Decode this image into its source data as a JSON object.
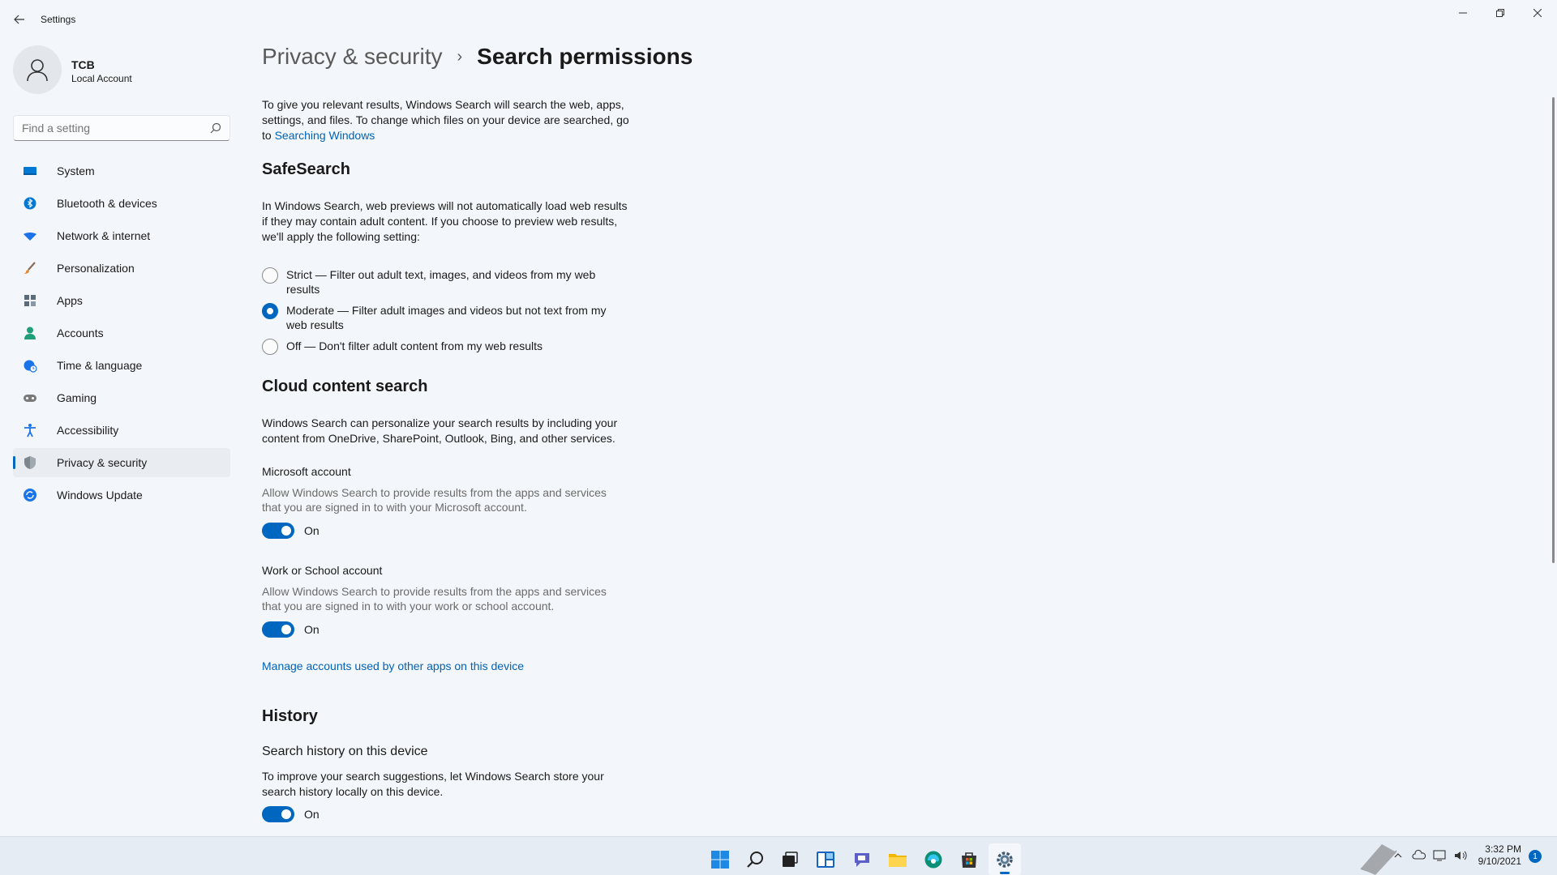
{
  "window": {
    "title": "Settings"
  },
  "profile": {
    "name": "TCB",
    "account_type": "Local Account"
  },
  "search": {
    "placeholder": "Find a setting"
  },
  "sidebar": {
    "items": [
      {
        "label": "System",
        "icon": "system-icon",
        "color": "#0078d4"
      },
      {
        "label": "Bluetooth & devices",
        "icon": "bluetooth-icon",
        "color": "#0078d4"
      },
      {
        "label": "Network & internet",
        "icon": "wifi-icon",
        "color": "#1a73e8"
      },
      {
        "label": "Personalization",
        "icon": "brush-icon",
        "color": "#c16c3a"
      },
      {
        "label": "Apps",
        "icon": "apps-icon",
        "color": "#4f5b66"
      },
      {
        "label": "Accounts",
        "icon": "person-icon",
        "color": "#1f9e7a"
      },
      {
        "label": "Time & language",
        "icon": "globe-clock-icon",
        "color": "#1a73e8"
      },
      {
        "label": "Gaming",
        "icon": "gamepad-icon",
        "color": "#6b6b6b"
      },
      {
        "label": "Accessibility",
        "icon": "accessibility-icon",
        "color": "#1a73e8"
      },
      {
        "label": "Privacy & security",
        "icon": "shield-icon",
        "color": "#6b6b6b",
        "active": true
      },
      {
        "label": "Windows Update",
        "icon": "update-icon",
        "color": "#1a73e8"
      }
    ]
  },
  "breadcrumb": {
    "parent": "Privacy & security",
    "separator": "›",
    "current": "Search permissions"
  },
  "intro": {
    "text": "To give you relevant results, Windows Search will search the web, apps, settings, and files. To change which files on your device are searched, go to",
    "link": "Searching Windows"
  },
  "safesearch": {
    "heading": "SafeSearch",
    "description": "In Windows Search, web previews will not automatically load web results if they may contain adult content. If you choose to preview web results, we'll apply the following setting:",
    "options": [
      {
        "label": "Strict — Filter out adult text, images, and videos from my web results",
        "checked": false
      },
      {
        "label": "Moderate — Filter adult images and videos but not text from my web results",
        "checked": true
      },
      {
        "label": "Off — Don't filter adult content from my web results",
        "checked": false
      }
    ]
  },
  "cloud": {
    "heading": "Cloud content search",
    "description": "Windows Search can personalize your search results by including your content from OneDrive, SharePoint, Outlook, Bing, and other services.",
    "microsoft": {
      "label": "Microsoft account",
      "description": "Allow Windows Search to provide results from the apps and services that you are signed in to with your Microsoft account.",
      "state": "On"
    },
    "work": {
      "label": "Work or School account",
      "description": "Allow Windows Search to provide results from the apps and services that you are signed in to with your work or school account.",
      "state": "On"
    },
    "manage_link": "Manage accounts used by other apps on this device"
  },
  "history": {
    "heading": "History",
    "label": "Search history on this device",
    "description": "To improve your search suggestions, let Windows Search store your search history locally on this device.",
    "state": "On"
  },
  "taskbar": {
    "icons": [
      "windows-start-icon",
      "search-icon",
      "task-view-icon",
      "widgets-icon",
      "chat-icon",
      "file-explorer-icon",
      "edge-icon",
      "store-icon",
      "settings-icon"
    ],
    "time": "3:32 PM",
    "date": "9/10/2021",
    "notifications": "1"
  },
  "accent_color": "#0067c0"
}
